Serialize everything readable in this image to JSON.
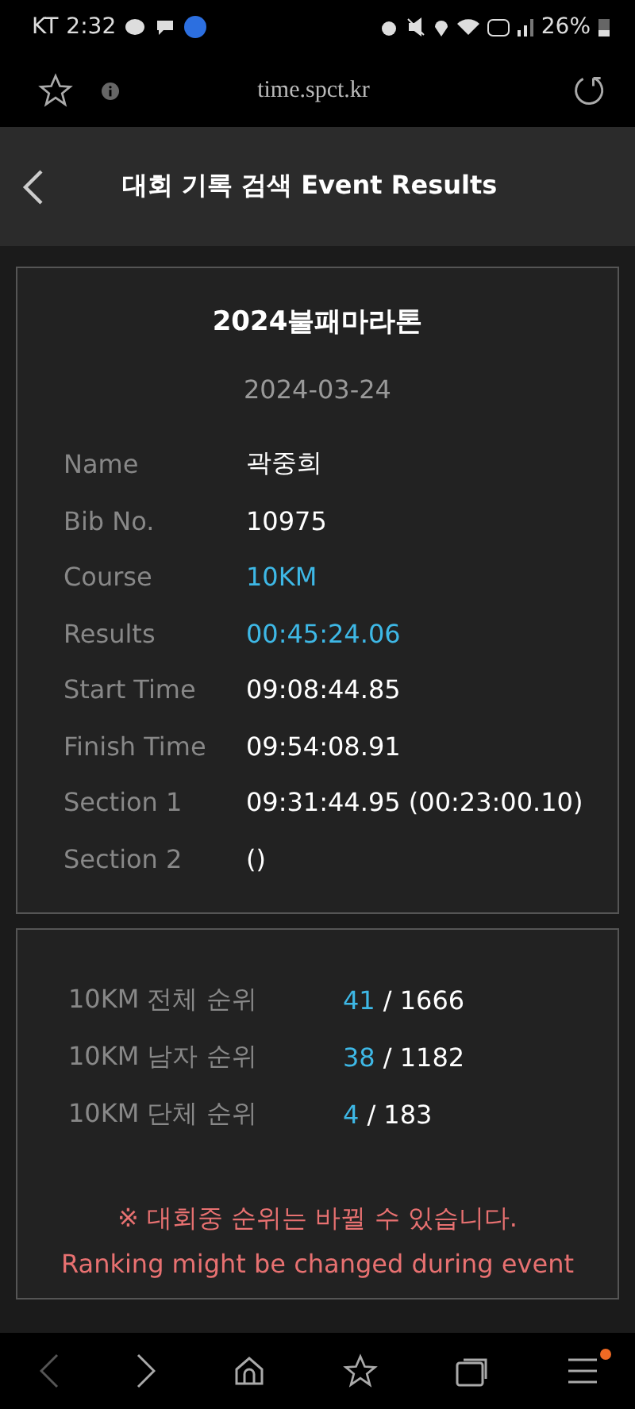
{
  "status_bar": {
    "carrier": "KT",
    "time": "2:32",
    "battery": "26%"
  },
  "browser": {
    "url": "time.spct.kr"
  },
  "header": {
    "title": "대회 기록 검색 Event Results"
  },
  "record": {
    "event": "2024불패마라톤",
    "date": "2024-03-24",
    "rows": [
      {
        "label": "Name",
        "value": "곽중희",
        "accent": false
      },
      {
        "label": "Bib No.",
        "value": "10975",
        "accent": false
      },
      {
        "label": "Course",
        "value": "10KM",
        "accent": true
      },
      {
        "label": "Results",
        "value": "00:45:24.06",
        "accent": true
      },
      {
        "label": "Start Time",
        "value": "09:08:44.85",
        "accent": false
      },
      {
        "label": "Finish Time",
        "value": "09:54:08.91",
        "accent": false
      },
      {
        "label": "Section 1",
        "value": "09:31:44.95 (00:23:00.10)",
        "accent": false
      },
      {
        "label": "Section 2",
        "value": "()",
        "accent": false
      }
    ]
  },
  "ranking": {
    "rows": [
      {
        "label": "10KM 전체 순위",
        "rank": "41",
        "total": "/ 1666"
      },
      {
        "label": "10KM 남자 순위",
        "rank": "38",
        "total": "/ 1182"
      },
      {
        "label": "10KM 단체 순위",
        "rank": "4",
        "total": "/ 183"
      }
    ],
    "notice_ko": "※ 대회중 순위는 바뀔 수 있습니다.",
    "notice_en": "Ranking might be changed during event"
  },
  "bottom_nav": {
    "menu_badge": true
  }
}
